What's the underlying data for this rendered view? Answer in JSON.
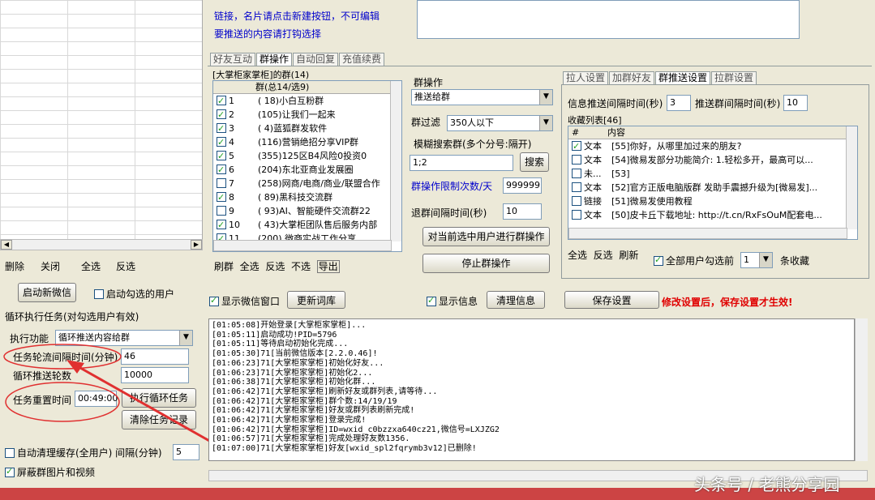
{
  "top": {
    "hint_line1": "链接，名片请点击新建按钮，不可编辑",
    "hint_line2": "要推送的内容请打钩选择"
  },
  "main_tabs": [
    "好友互动",
    "群操作",
    "自动回复",
    "充值续费"
  ],
  "group_list": {
    "title": "[大掌柜家掌柜]的群(14)",
    "header": "群(总14/选9)",
    "rows": [
      {
        "idx": "1",
        "checked": true,
        "text": "( 18)小白互粉群"
      },
      {
        "idx": "2",
        "checked": true,
        "text": "(105)让我们一起来"
      },
      {
        "idx": "3",
        "checked": true,
        "text": "(  4)蓝狐群发软件"
      },
      {
        "idx": "4",
        "checked": true,
        "text": "(116)营销绝招分享VIP群"
      },
      {
        "idx": "5",
        "checked": true,
        "text": "(355)125区B4风险0投资0"
      },
      {
        "idx": "6",
        "checked": true,
        "text": "(204)东北亚商业发展圈"
      },
      {
        "idx": "7",
        "checked": false,
        "text": "(258)网商/电商/商业/联盟合作"
      },
      {
        "idx": "8",
        "checked": true,
        "text": "( 89)黑科技交流群"
      },
      {
        "idx": "9",
        "checked": false,
        "text": "( 93)AI、智能硬件交流群22"
      },
      {
        "idx": "10",
        "checked": true,
        "text": "( 43)大掌柜团队售后服务内部"
      },
      {
        "idx": "11",
        "checked": true,
        "text": "(200)  微商实战工作分享"
      }
    ],
    "actions": [
      "刷群",
      "全选",
      "反选",
      "不选",
      "导出"
    ]
  },
  "group_ops": {
    "label": "群操作",
    "op_value": "推送给群",
    "filter_label": "群过滤",
    "filter_value": "350人以下",
    "fuzzy_label": "模糊搜索群(多个分号:隔开)",
    "fuzzy_value": "1;2",
    "search_btn": "搜索",
    "limit_label": "群操作限制次数/天",
    "limit_value": "999999",
    "exit_label": "退群间隔时间(秒)",
    "exit_value": "10",
    "apply_btn": "对当前选中用户进行群操作",
    "stop_btn": "停止群操作"
  },
  "right_tabs": [
    "拉人设置",
    "加群好友",
    "群推送设置",
    "拉群设置"
  ],
  "push_settings": {
    "interval_label": "信息推送间隔时间(秒)",
    "interval_value": "3",
    "group_interval_label": "推送群间隔时间(秒)",
    "group_interval_value": "10",
    "fav_title": "收藏列表[46]",
    "col_hash": "#",
    "col_content": "内容",
    "favorites": [
      {
        "checked": true,
        "type": "文本",
        "text": "[55]你好，从哪里加过来的朋友?"
      },
      {
        "checked": false,
        "type": "文本",
        "text": "[54]微易发部分功能简介: 1.轻松多开，最高可以..."
      },
      {
        "checked": false,
        "type": "未...",
        "text": "[53]"
      },
      {
        "checked": false,
        "type": "文本",
        "text": "[52]官方正版电脑版群 发助手震撼升级为[微易发]..."
      },
      {
        "checked": false,
        "type": "链接",
        "text": "[51]微易发使用教程"
      },
      {
        "checked": false,
        "type": "文本",
        "text": "[50]皮卡丘下载地址: http://t.cn/RxFsOuM配套电..."
      }
    ],
    "actions": [
      "全选",
      "反选",
      "刷新"
    ],
    "all_users_label": "全部用户勾选前",
    "count_value": "1",
    "count_suffix": "条收藏"
  },
  "bottom_bar": {
    "show_wechat_label": "显示微信窗口",
    "refresh_btn": "更新词库",
    "show_info_label": "显示信息",
    "clear_btn": "清理信息",
    "save_btn": "保存设置",
    "save_warning": "修改设置后，保存设置才生效!"
  },
  "left_panel": {
    "menu": [
      "删除",
      "关闭",
      "全选",
      "反选"
    ],
    "start_btn": "启动新微信",
    "start_checked_label": "启动勾选的用户",
    "loop_title": "循环执行任务(对勾选用户有效)",
    "exec_label": "执行功能",
    "exec_value": "循环推送内容给群",
    "interval_label": "任务轮流间隔时间(分钟)",
    "interval_value": "46",
    "rounds_label": "循环推送轮数",
    "rounds_value": "10000",
    "reset_label": "任务重置时间",
    "reset_value": "00:49:00",
    "exec_loop_btn": "执行循环任务",
    "clear_task_btn": "清除任务记录",
    "auto_clean_label": "自动清理缓存(全用户) 间隔(分钟)",
    "auto_clean_value": "5",
    "block_media_label": "屏蔽群图片和视频"
  },
  "log_lines": [
    "[01:05:08]开始登录[大掌柜家掌柜]...",
    "[01:05:11]启动成功!PID=5796",
    "[01:05:11]等待启动初始化完成...",
    "[01:05:30]71[当前微信版本[2.2.0.46]!",
    "[01:06:23]71[大掌柜家掌柜]初始化好友...",
    "[01:06:23]71[大掌柜家掌柜]初始化2...",
    "[01:06:38]71[大掌柜家掌柜]初始化群...",
    "[01:06:42]71[大掌柜家掌柜]刷新好友或群列表,请等待...",
    "[01:06:42]71[大掌柜家掌柜]群个数:14/19/19",
    "[01:06:42]71[大掌柜家掌柜]好友或群列表刷新完成!",
    "[01:06:42]71[大掌柜家掌柜]登录完成!",
    "[01:06:42]71[大掌柜家掌柜]ID=wxid_c0bzzxa640cz21,微信号=LXJZG2",
    "[01:06:57]71[大掌柜家掌柜]完成处理好友数1356.",
    "[01:07:00]71[大掌柜家掌柜]好友[wxid_spl2fqrymb3v12]已删除!"
  ],
  "watermark": "头条号 / 老熊分享园",
  "colors": {
    "warning": "#e00000",
    "annotation": "#e03030",
    "link_blue": "#0000cc"
  }
}
